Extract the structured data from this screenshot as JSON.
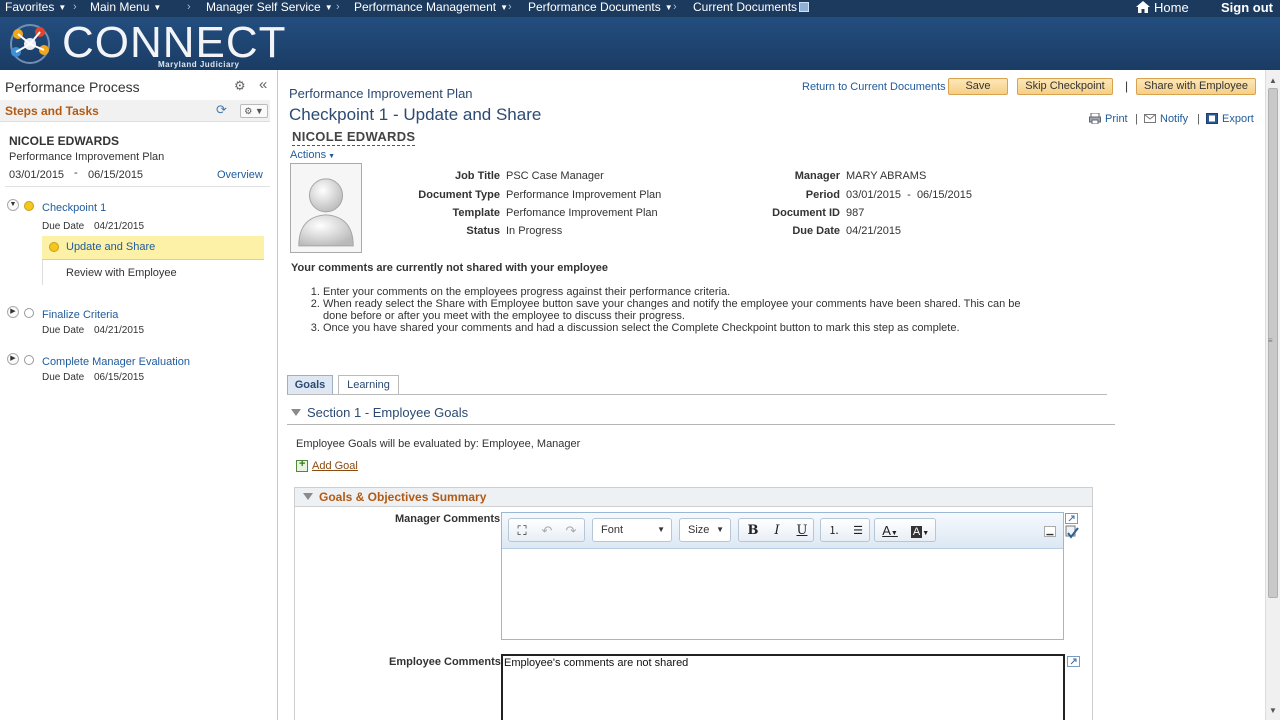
{
  "topnav": {
    "items": [
      "Favorites",
      "Main Menu",
      "Manager Self Service",
      "Performance Management",
      "Performance Documents",
      "Current Documents"
    ],
    "home": "Home",
    "signout": "Sign out"
  },
  "banner": {
    "logo_text": "CONNECT",
    "logo_sub": "Maryland Judiciary"
  },
  "left": {
    "title": "Performance Process",
    "steps_title": "Steps and Tasks",
    "employee": "NICOLE EDWARDS",
    "plan": "Performance Improvement Plan",
    "date_start": "03/01/2015",
    "date_sep": "-",
    "date_end": "06/15/2015",
    "overview": "Overview",
    "due_label": "Due Date",
    "steps": [
      {
        "label": "Checkpoint 1",
        "due": "04/21/2015"
      },
      {
        "label": "Finalize Criteria",
        "due": "04/21/2015"
      },
      {
        "label": "Complete Manager Evaluation",
        "due": "06/15/2015"
      }
    ],
    "substeps": [
      "Update and Share",
      "Review with Employee"
    ]
  },
  "main": {
    "doc_type_title": "Performance Improvement Plan",
    "return_link": "Return to Current Documents",
    "save": "Save",
    "skip": "Skip Checkpoint",
    "pipe": "|",
    "share": "Share with Employee",
    "checkpoint_title": "Checkpoint 1 - Update and Share",
    "print": "Print",
    "notify": "Notify",
    "export": "Export",
    "employee": "NICOLE EDWARDS",
    "actions": "Actions",
    "fields": {
      "job_title_label": "Job Title",
      "job_title": "PSC Case Manager",
      "doc_type_label": "Document Type",
      "doc_type": "Performance Improvement Plan",
      "template_label": "Template",
      "template": "Perfomance Improvement Plan",
      "status_label": "Status",
      "status": "In Progress",
      "manager_label": "Manager",
      "manager": "MARY ABRAMS",
      "period_label": "Period",
      "period": "03/01/2015  -  06/15/2015",
      "doc_id_label": "Document ID",
      "doc_id": "987",
      "due_label": "Due Date",
      "due": "04/21/2015"
    },
    "not_shared": "Your comments are currently not shared with your employee",
    "instructions": [
      "Enter your comments on the employees progress against their performance criteria.",
      "When ready select the Share with Employee button save your changes and notify the employee your comments have been shared. This can be done before or after you meet with the employee to discuss their progress.",
      "Once you have shared your comments and had a discussion select the Complete Checkpoint button to mark this step as complete."
    ],
    "tabs": [
      "Goals",
      "Learning"
    ],
    "section_title": "Section 1 - Employee Goals",
    "evaluated_by": "Employee Goals will be evaluated by: Employee, Manager",
    "add_goal": "Add Goal",
    "goals_summary": "Goals & Objectives Summary",
    "manager_comments_label": "Manager Comments",
    "employee_comments_label": "Employee Comments",
    "employee_comments_value": "Employee's comments are not shared",
    "editor": {
      "font": "Font",
      "size": "Size",
      "bold": "B",
      "italic": "I",
      "underline": "U",
      "text_color": "A",
      "bg_color": "A"
    }
  },
  "colors": {
    "nav": "#1c3a5e",
    "accent": "#b25a14",
    "link": "#1f5b9c",
    "button": "#f6cf86"
  }
}
